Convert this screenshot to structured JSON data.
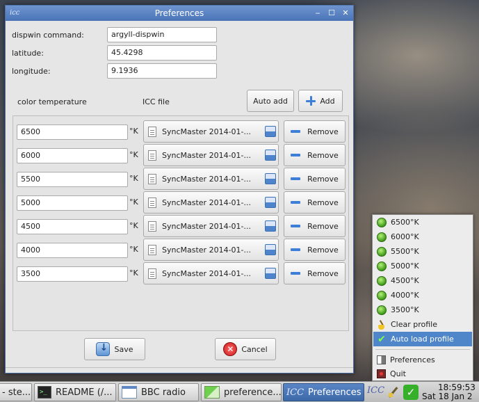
{
  "window": {
    "title": "Preferences",
    "app_icon": "icc",
    "controls": {
      "minimize": "‒",
      "maximize": "☐",
      "close": "✕"
    }
  },
  "fields": {
    "dispwin": {
      "label": "dispwin command:",
      "value": "argyll-dispwin"
    },
    "latitude": {
      "label": "latitude:",
      "value": "45.4298"
    },
    "longitude": {
      "label": "longitude:",
      "value": "9.1936"
    }
  },
  "headers": {
    "color_temperature": "color temperature",
    "icc_file": "ICC file"
  },
  "buttons": {
    "auto_add": "Auto add",
    "add": "Add",
    "save": "Save",
    "cancel": "Cancel",
    "remove": "Remove"
  },
  "unit": "°K",
  "profiles": [
    {
      "temperature": "6500",
      "icc": "SyncMaster 2014-01-..."
    },
    {
      "temperature": "6000",
      "icc": "SyncMaster 2014-01-..."
    },
    {
      "temperature": "5500",
      "icc": "SyncMaster 2014-01-..."
    },
    {
      "temperature": "5000",
      "icc": "SyncMaster 2014-01-..."
    },
    {
      "temperature": "4500",
      "icc": "SyncMaster 2014-01-..."
    },
    {
      "temperature": "4000",
      "icc": "SyncMaster 2014-01-..."
    },
    {
      "temperature": "3500",
      "icc": "SyncMaster 2014-01-..."
    }
  ],
  "tray_menu": {
    "temps": [
      "6500°K",
      "6000°K",
      "5500°K",
      "5000°K",
      "4500°K",
      "4000°K",
      "3500°K"
    ],
    "clear_profile": "Clear profile",
    "auto_load_profile": "Auto load profile",
    "preferences": "Preferences",
    "quit": "Quit",
    "highlight_color": "#4f86c9"
  },
  "taskbar": {
    "tasks": [
      {
        "label": "- ste...",
        "icon": "none"
      },
      {
        "label": "README (/...",
        "icon": "terminal-icon"
      },
      {
        "label": "BBC radio",
        "icon": "window-icon"
      },
      {
        "label": "preference...",
        "icon": "image-icon"
      },
      {
        "label": "Preferences",
        "icon": "icc-icon",
        "app_icon": "ICC",
        "active": true
      }
    ],
    "tray_icc": "ICC",
    "tray_ok": "✓",
    "clock_time": "18:59:53",
    "clock_date": "Sat 18 Jan 2"
  }
}
